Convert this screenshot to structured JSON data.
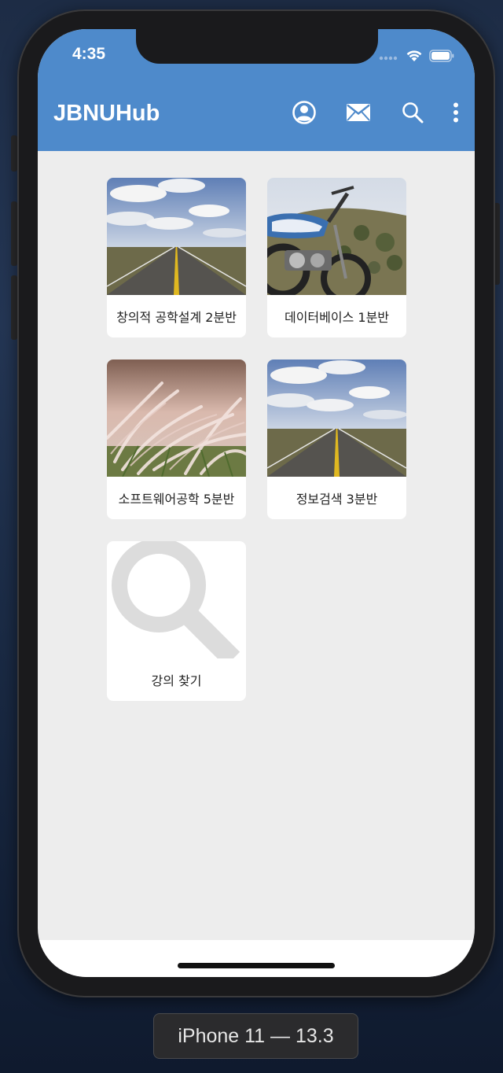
{
  "status_bar": {
    "time": "4:35"
  },
  "app_bar": {
    "title": "JBNUHub",
    "actions": [
      "account-icon",
      "mail-icon",
      "search-icon",
      "more-vert-icon"
    ]
  },
  "courses": [
    {
      "label": "창의적 공학설계 2분반",
      "thumbnail": "road"
    },
    {
      "label": "데이터베이스 1분반",
      "thumbnail": "motorcycle"
    },
    {
      "label": "소프트웨어공학 5분반",
      "thumbnail": "grass"
    },
    {
      "label": "정보검색 3분반",
      "thumbnail": "road"
    }
  ],
  "find_course": {
    "label": "강의 찾기",
    "icon": "search-icon"
  },
  "device_label": "iPhone 11 — 13.3",
  "colors": {
    "app_bar": "#4e8acb",
    "background": "#ededed"
  }
}
